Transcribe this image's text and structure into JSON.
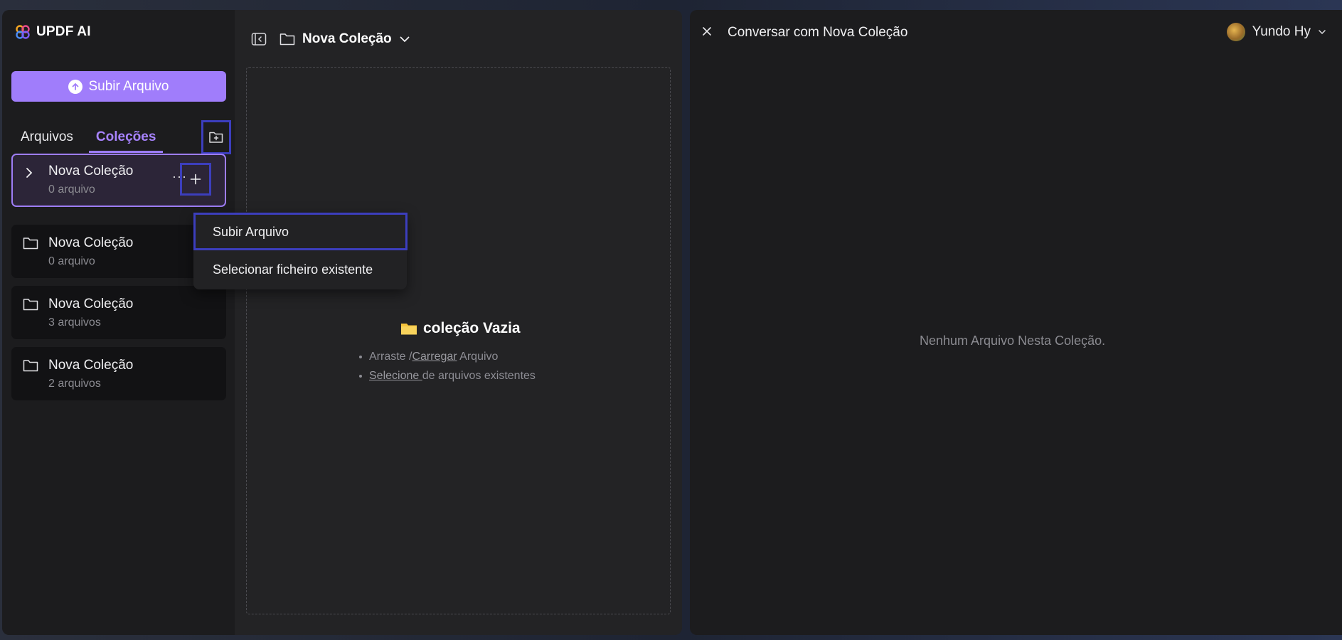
{
  "sidebar": {
    "brand": "UPDF AI",
    "upload_label": "Subir Arquivo",
    "tabs": [
      "Arquivos",
      "Coleções"
    ],
    "collections": [
      {
        "name": "Nova Coleção",
        "count": "0 arquivo"
      },
      {
        "name": "Nova Coleção",
        "count": "0 arquivo"
      },
      {
        "name": "Nova Coleção",
        "count": "3 arquivos"
      },
      {
        "name": "Nova Coleção",
        "count": "2 arquivos"
      }
    ],
    "more_label": "···"
  },
  "menu": {
    "items": [
      "Subir Arquivo",
      "Selecionar ficheiro existente"
    ]
  },
  "main": {
    "breadcrumb_title": "Nova Coleção",
    "empty_title": "coleção Vazia",
    "hint1_prefix": "Arraste /",
    "hint1_link": "Carregar",
    "hint1_suffix": " Arquivo",
    "hint2_link": " Selecione ",
    "hint2_suffix": " de arquivos existentes"
  },
  "chat": {
    "title": "Conversar com Nova Coleção",
    "user_name": "Yundo Hy",
    "empty_message": "Nenhum Arquivo Nesta Coleção."
  },
  "colors": {
    "accent": "#a07dfb",
    "highlight_border": "#3c3ebd",
    "folder_yellow": "#f5c33b"
  }
}
